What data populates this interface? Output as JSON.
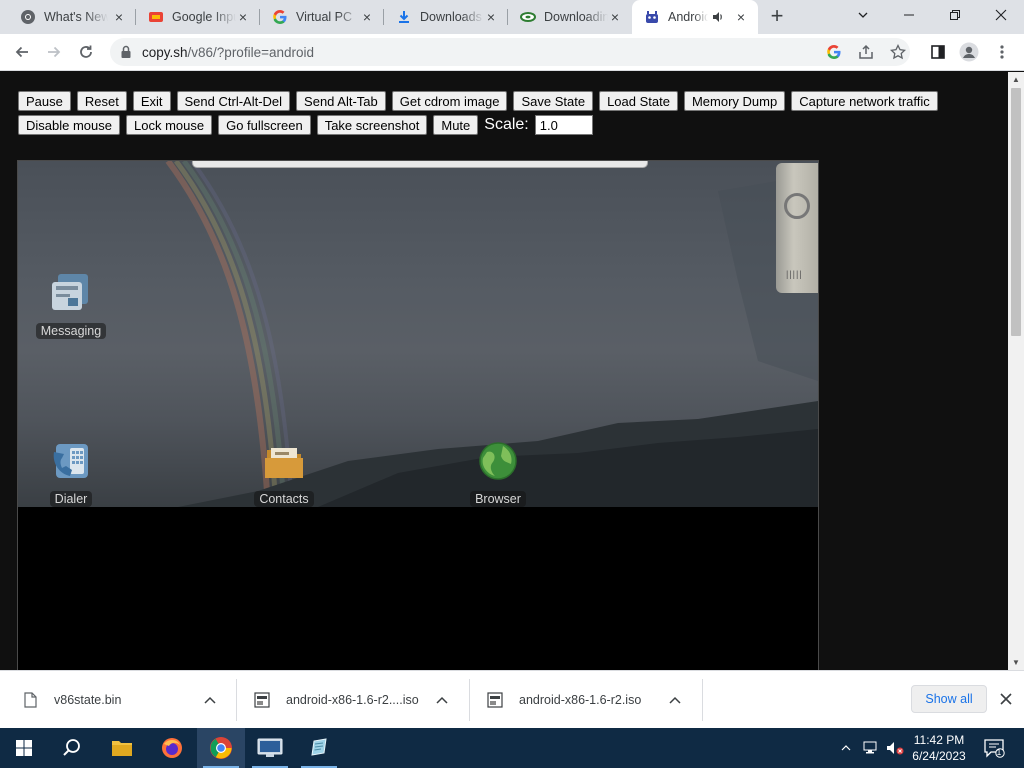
{
  "browser": {
    "tabs": [
      {
        "title": "What's New",
        "icon": "chrome-logo-icon"
      },
      {
        "title": "Google Input Tools",
        "icon": "google-input-icon"
      },
      {
        "title": "Virtual PC",
        "icon": "google-g-icon"
      },
      {
        "title": "Downloads",
        "icon": "download-icon"
      },
      {
        "title": "Downloading",
        "icon": "green-disc-icon"
      },
      {
        "title": "Android",
        "icon": "android-icon",
        "active": true,
        "audio": true
      }
    ],
    "url_host": "copy.sh",
    "url_path": "/v86/?profile=android"
  },
  "emulator": {
    "buttons_row1": [
      "Pause",
      "Reset",
      "Exit",
      "Send Ctrl-Alt-Del",
      "Send Alt-Tab",
      "Get cdrom image",
      "Save State",
      "Load State",
      "Memory Dump",
      "Capture network traffic"
    ],
    "buttons_row2": [
      "Disable mouse",
      "Lock mouse",
      "Go fullscreen",
      "Take screenshot",
      "Mute"
    ],
    "scale_label": "Scale:",
    "scale_value": "1.0"
  },
  "android": {
    "apps": [
      {
        "label": "Messaging",
        "icon": "messaging-icon"
      },
      {
        "label": "Dialer",
        "icon": "dialer-icon"
      },
      {
        "label": "Contacts",
        "icon": "contacts-icon"
      },
      {
        "label": "Browser",
        "icon": "globe-icon"
      }
    ],
    "grill_text": "|||||"
  },
  "downloads": {
    "items": [
      {
        "name": "v86state.bin",
        "icon": "file-icon"
      },
      {
        "name": "android-x86-1.6-r2....iso",
        "icon": "disc-image-icon"
      },
      {
        "name": "android-x86-1.6-r2.iso",
        "icon": "disc-image-icon"
      }
    ],
    "show_all": "Show all"
  },
  "taskbar": {
    "time": "11:42 PM",
    "date": "6/24/2023",
    "notification_count": "1"
  },
  "colors": {
    "taskbar": "#0f2a44",
    "tabstrip": "#dee1e6",
    "accent_link": "#1a73e8",
    "page_bg": "#101010"
  }
}
